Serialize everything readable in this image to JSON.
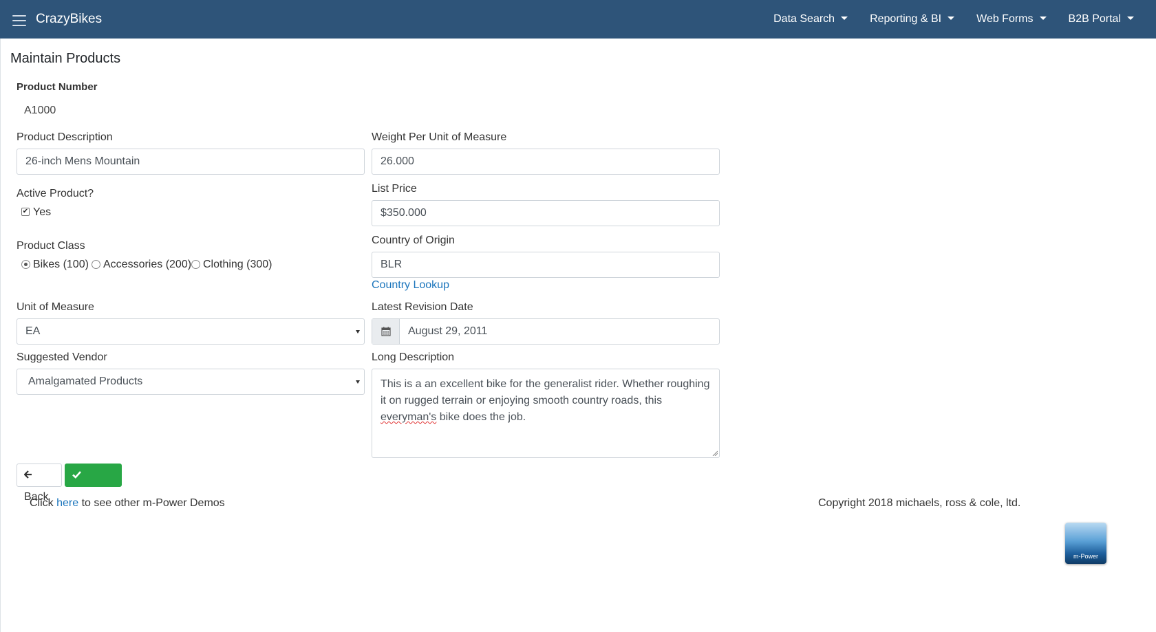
{
  "header": {
    "brand": "CrazyBikes",
    "menu": [
      {
        "label": "Data Search"
      },
      {
        "label": "Reporting & BI"
      },
      {
        "label": "Web Forms"
      },
      {
        "label": "B2B Portal"
      }
    ]
  },
  "page": {
    "title": "Maintain Products"
  },
  "form": {
    "product_number": {
      "label": "Product Number",
      "value": "A1000"
    },
    "product_description": {
      "label": "Product Description",
      "value": "26-inch Mens Mountain"
    },
    "weight": {
      "label": "Weight Per Unit of Measure",
      "value": "26.000"
    },
    "active": {
      "label": "Active Product?",
      "option": "Yes",
      "checked": true
    },
    "list_price": {
      "label": "List Price",
      "value": "$350.000"
    },
    "product_class": {
      "label": "Product Class",
      "options": [
        "Bikes (100)",
        "Accessories (200)",
        "Clothing (300)"
      ],
      "selected": "Bikes (100)"
    },
    "country": {
      "label": "Country of Origin",
      "value": "BLR",
      "lookup_link": "Country Lookup"
    },
    "unit_of_measure": {
      "label": "Unit of Measure",
      "value": "EA"
    },
    "revision_date": {
      "label": "Latest Revision Date",
      "value": "August 29, 2011"
    },
    "vendor": {
      "label": "Suggested Vendor",
      "value": "Amalgamated Products"
    },
    "long_description": {
      "label": "Long Description",
      "text_before": "This is a an excellent bike for the generalist rider. Whether roughing it on rugged terrain or enjoying smooth country roads, this ",
      "misspelled": "everyman's",
      "text_after": " bike does the job."
    }
  },
  "buttons": {
    "back": "Back",
    "accept": "Accept"
  },
  "footer": {
    "click_prefix": "Click ",
    "click_link": "here",
    "click_suffix": " to see other m-Power Demos",
    "copyright": "Copyright 2018 michaels, ross & cole, ltd.",
    "logo_text": "m-Power"
  },
  "colors": {
    "navbar": "#2e5479",
    "accept": "#28a745",
    "link": "#1b75bc"
  }
}
